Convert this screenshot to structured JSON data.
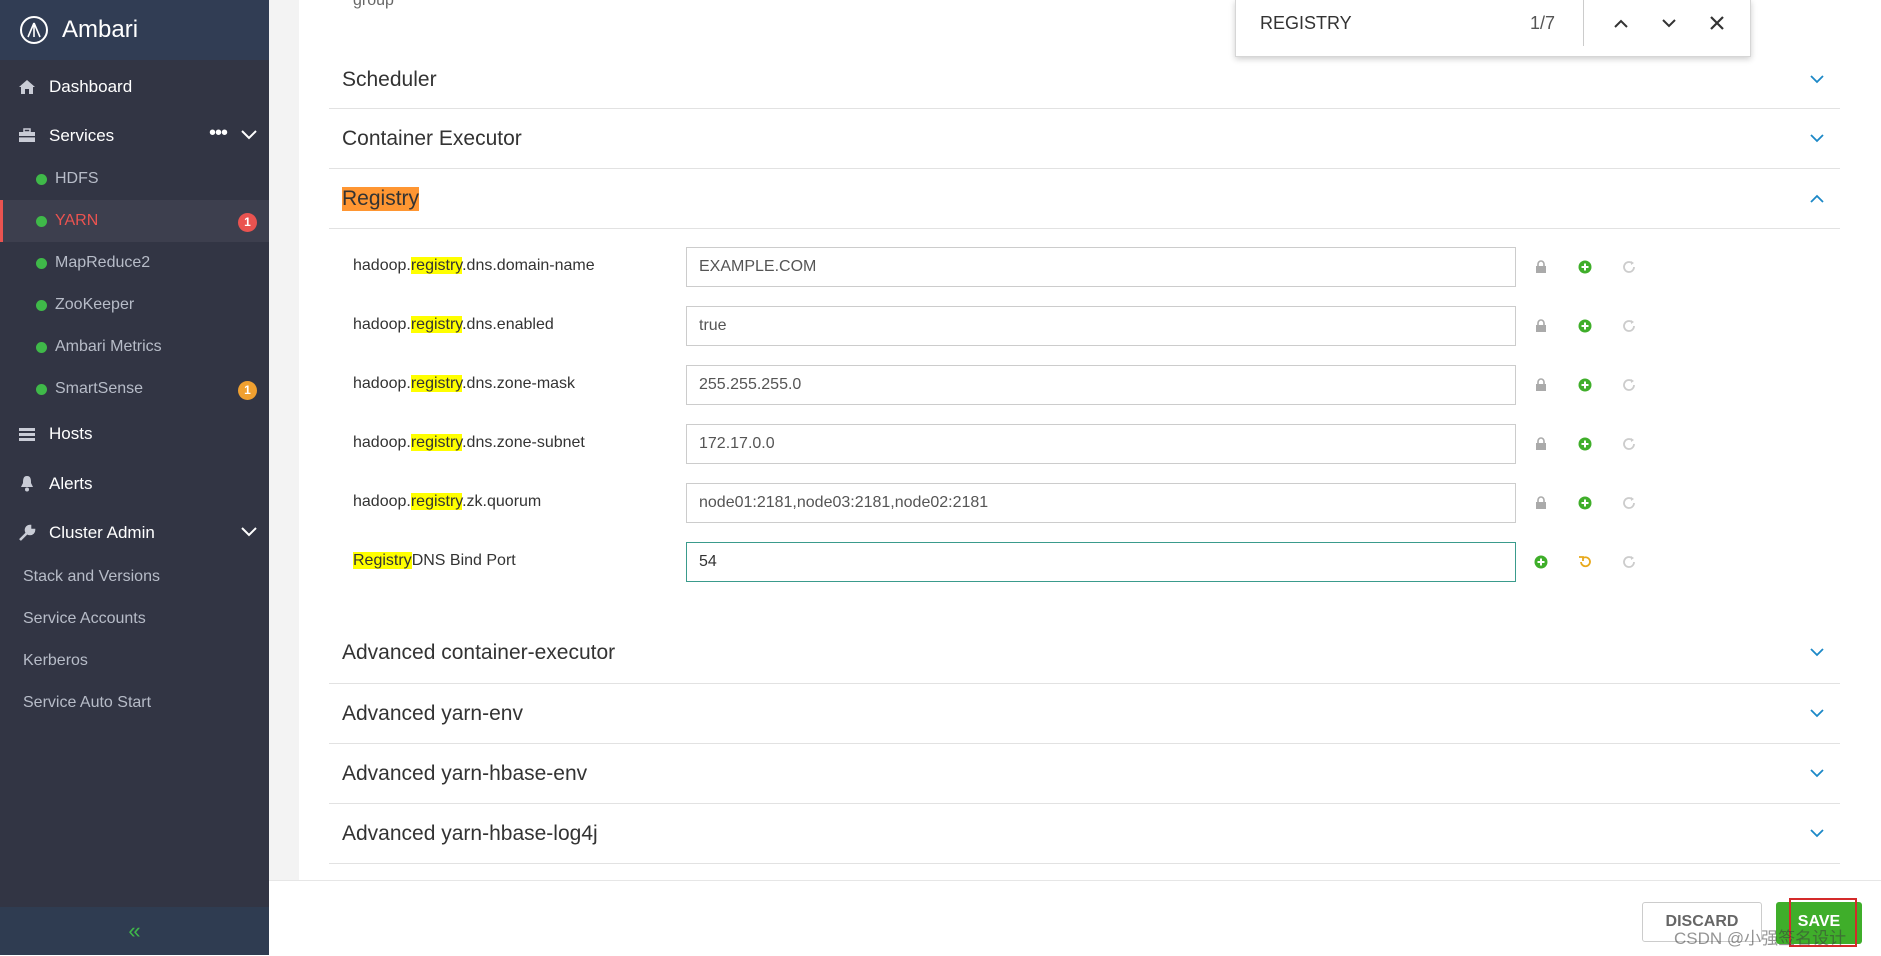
{
  "brand": {
    "name": "Ambari"
  },
  "sidebar": {
    "dashboard": "Dashboard",
    "services": "Services",
    "services_more": "•••",
    "service_items": [
      {
        "label": "HDFS",
        "status_color": "#3fb949"
      },
      {
        "label": "YARN",
        "status_color": "#3fb949",
        "badge": "1",
        "badge_color": "#ea5350",
        "active": true
      },
      {
        "label": "MapReduce2",
        "status_color": "#3fb949"
      },
      {
        "label": "ZooKeeper",
        "status_color": "#3fb949"
      },
      {
        "label": "Ambari Metrics",
        "status_color": "#3fb949"
      },
      {
        "label": "SmartSense",
        "status_color": "#3fb949",
        "badge": "1",
        "badge_color": "#f0a030"
      }
    ],
    "hosts": "Hosts",
    "alerts": "Alerts",
    "cluster_admin": "Cluster Admin",
    "cluster_admin_items": [
      "Stack and Versions",
      "Service Accounts",
      "Kerberos",
      "Service Auto Start"
    ],
    "collapse_symbol": "«"
  },
  "main": {
    "fragment_label": "group",
    "sections": {
      "scheduler": "Scheduler",
      "container_executor": "Container Executor",
      "registry": "Registry",
      "adv_container_executor": "Advanced container-executor",
      "adv_yarn_env": "Advanced yarn-env",
      "adv_yarn_hbase_env": "Advanced yarn-hbase-env",
      "adv_yarn_hbase_log4j": "Advanced yarn-hbase-log4j"
    },
    "registry_props": [
      {
        "prefix": "hadoop.",
        "match": "registry",
        "suffix": ".dns.domain-name",
        "value": "EXAMPLE.COM"
      },
      {
        "prefix": "hadoop.",
        "match": "registry",
        "suffix": ".dns.enabled",
        "value": "true"
      },
      {
        "prefix": "hadoop.",
        "match": "registry",
        "suffix": ".dns.zone-mask",
        "value": "255.255.255.0"
      },
      {
        "prefix": "hadoop.",
        "match": "registry",
        "suffix": ".dns.zone-subnet",
        "value": "172.17.0.0"
      },
      {
        "prefix": "hadoop.",
        "match": "registry",
        "suffix": ".zk.quorum",
        "value": "node01:2181,node03:2181,node02:2181"
      },
      {
        "prefix": "",
        "match": "Registry",
        "suffix": "DNS Bind Port",
        "value": "54"
      }
    ]
  },
  "find": {
    "query": "REGISTRY",
    "count": "1/7"
  },
  "footer": {
    "discard": "DISCARD",
    "save": "SAVE",
    "watermark": "CSDN @小强签名设计"
  },
  "colors": {
    "accent_red": "#ea5350",
    "save_green": "#3fae2a",
    "highlight_orange": "#ff9632",
    "highlight_yellow": "#ffff00",
    "icon_green": "#3fae2a"
  }
}
